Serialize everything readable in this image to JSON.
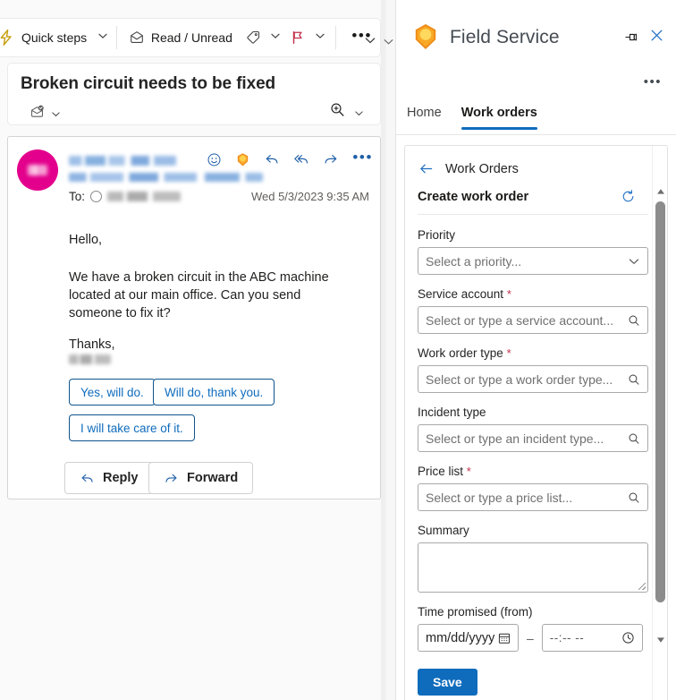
{
  "mail": {
    "ribbon": {
      "quick_steps_label": "Quick steps",
      "quick_steps_icon": "lightning-bolt-icon",
      "quick_steps_caret_icon": "chevron-down-icon",
      "read_unread_label": "Read / Unread",
      "read_unread_icon": "envelope-open-icon",
      "tag_icon": "tag-icon",
      "tag_caret_icon": "chevron-down-icon",
      "flag_icon": "flag-icon",
      "flag_caret_icon": "chevron-down-icon",
      "more_icon": "ellipsis-horizontal-icon",
      "overflow_caret_icon": "chevron-down-icon",
      "flag_color": "#c4314b",
      "bolt_color": "#c8a217"
    },
    "subject": {
      "title": "Broken circuit needs to be fixed",
      "mail_status_icon": "mail-read-check-icon",
      "mail_status_caret_icon": "chevron-down-icon",
      "zoom_icon": "magnifier-plus-icon",
      "zoom_caret_icon": "chevron-down-icon"
    },
    "message": {
      "avatar_color": "#e3008c",
      "avatar_initials": "",
      "sender_name": "",
      "sender_email": "",
      "to_label": "To:",
      "to_name": "",
      "date": "Wed 5/3/2023 9:35 AM",
      "header_icons": [
        "emoji-react-icon",
        "field-service-app-icon",
        "reply-icon",
        "reply-all-icon",
        "forward-icon",
        "ellipsis-horizontal-icon"
      ],
      "body": {
        "greeting": "Hello,",
        "paragraph": "We have a broken circuit in the ABC machine located at   our main office. Can you send someone to fix it?",
        "closing": "Thanks,",
        "signature": ""
      },
      "suggested_replies": [
        "Yes, will do.",
        "Will do, thank you.",
        "I will take care of it."
      ],
      "actions": [
        {
          "label": "Reply",
          "icon": "reply-icon"
        },
        {
          "label": "Forward",
          "icon": "forward-icon"
        }
      ]
    },
    "pane_strip": {
      "caret_icon": "chevron-down-icon"
    }
  },
  "field_service": {
    "app_title": "Field Service",
    "logo_icon": "field-service-logo-icon",
    "pin_icon": "pin-icon",
    "close_icon": "close-icon",
    "overflow_icon": "ellipsis-horizontal-icon",
    "accent_color": "#0f6cbd",
    "tabs": [
      {
        "label": "Home",
        "active": false
      },
      {
        "label": "Work orders",
        "active": true
      }
    ],
    "form": {
      "back_label": "Work Orders",
      "back_icon": "arrow-left-icon",
      "heading": "Create work order",
      "refresh_icon": "refresh-icon",
      "fields": [
        {
          "label": "Priority",
          "required": false,
          "placeholder": "Select a priority...",
          "icon": "chevron-down-icon"
        },
        {
          "label": "Service account",
          "required": true,
          "placeholder": "Select or type a service account...",
          "icon": "search-icon"
        },
        {
          "label": "Work order type",
          "required": true,
          "placeholder": "Select or type a work order type...",
          "icon": "search-icon"
        },
        {
          "label": "Incident type",
          "required": false,
          "placeholder": "Select or type an incident type...",
          "icon": "search-icon"
        },
        {
          "label": "Price list",
          "required": true,
          "placeholder": "Select or type a price list...",
          "icon": "search-icon"
        },
        {
          "label": "Summary",
          "required": false,
          "placeholder": "",
          "icon": "resize-handle-icon"
        }
      ],
      "time_promised": {
        "label": "Time promised (from)",
        "date_placeholder": "mm/dd/yyyy",
        "date_icon": "calendar-icon",
        "separator": "–",
        "time_placeholder": "--:-- --",
        "time_icon": "clock-icon"
      },
      "save_label": "Save",
      "required_marker": "*",
      "scrollbar": {
        "up_icon": "triangle-up-icon",
        "down_icon": "triangle-down-icon"
      }
    }
  }
}
